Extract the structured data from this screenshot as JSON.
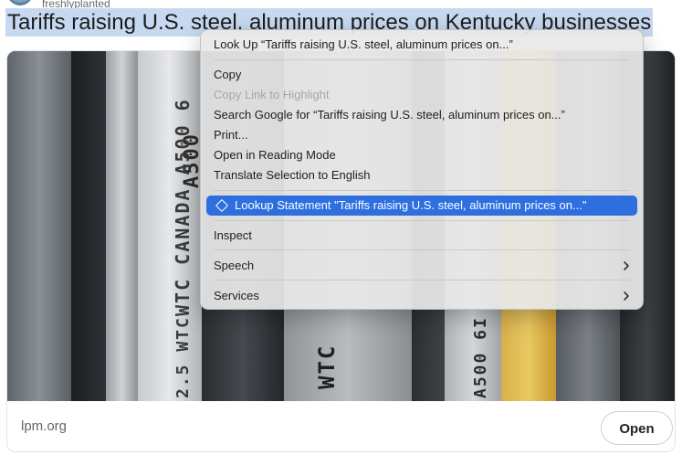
{
  "post": {
    "author": "freshlyplanted",
    "headline": "Tariffs raising U.S. steel, aluminum prices on Kentucky businesses",
    "stencils": [
      "A500",
      "WTC CANADA A500 6",
      "2.5 WTC",
      "WTC",
      "A500 6I"
    ]
  },
  "card": {
    "source": "lpm.org",
    "open_label": "Open"
  },
  "context_menu": {
    "look_up": "Look Up “Tariffs raising U.S. steel, aluminum prices on...”",
    "copy": "Copy",
    "copy_link_highlight": "Copy Link to Highlight",
    "search_google": "Search Google for “Tariffs raising U.S. steel, aluminum prices on...”",
    "print": "Print...",
    "reading_mode": "Open in Reading Mode",
    "translate": "Translate Selection to English",
    "lookup_statement": "Lookup Statement \"Tariffs raising U.S. steel, aluminum prices on...\"",
    "inspect": "Inspect",
    "speech": "Speech",
    "services": "Services"
  },
  "colors": {
    "selection": "#c6d9f0",
    "menu_highlight": "#2e6fe0"
  },
  "icons": [
    "diamond-icon",
    "chevron-right-icon"
  ]
}
